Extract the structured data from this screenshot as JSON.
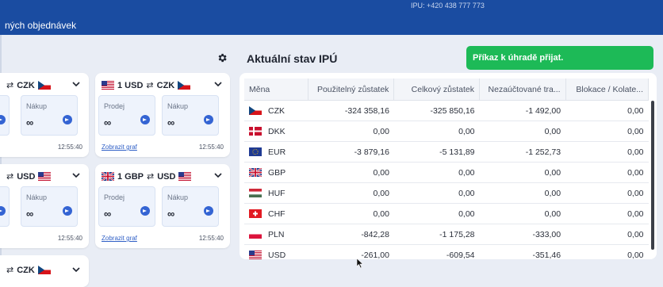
{
  "header": {
    "phone": "IPU: +420 438 777 773",
    "title": "ných objednávek"
  },
  "rates": [
    {
      "pair_base_amount": "",
      "pair_base": "",
      "pair_quote": "CZK",
      "buy_label": "Nákup",
      "buy_value": "∞",
      "time": "12:55:40"
    },
    {
      "pair_base_amount": "1 USD",
      "pair_quote": "CZK",
      "sell_label": "Prodej",
      "sell_value": "∞",
      "buy_label": "Nákup",
      "buy_value": "∞",
      "chart_link": "Zobrazit graf",
      "time": "12:55:40"
    },
    {
      "pair_quote": "USD",
      "buy_label": "Nákup",
      "buy_value": "∞",
      "time": "12:55:40"
    },
    {
      "pair_base_amount": "1 GBP",
      "pair_quote": "USD",
      "sell_label": "Prodej",
      "sell_value": "∞",
      "buy_label": "Nákup",
      "buy_value": "∞",
      "chart_link": "Zobrazit graf",
      "time": "12:55:40"
    },
    {
      "pair_quote": "CZK"
    }
  ],
  "status": {
    "title": "Aktuální stav IPÚ",
    "toast": "Příkaz k úhradě přijat."
  },
  "table": {
    "headers": [
      "Měna",
      "Použitelný zůstatek",
      "Celkový zůstatek",
      "Nezaúčtované tra...",
      "Blokace / Kolate..."
    ],
    "rows": [
      {
        "currency": "CZK",
        "flag": "cz",
        "usable": "-324 358,16",
        "total": "-325 850,16",
        "unposted": "-1 492,00",
        "blocked": "0,00"
      },
      {
        "currency": "DKK",
        "flag": "dk",
        "usable": "0,00",
        "total": "0,00",
        "unposted": "0,00",
        "blocked": "0,00"
      },
      {
        "currency": "EUR",
        "flag": "eu",
        "usable": "-3 879,16",
        "total": "-5 131,89",
        "unposted": "-1 252,73",
        "blocked": "0,00"
      },
      {
        "currency": "GBP",
        "flag": "gb",
        "usable": "0,00",
        "total": "0,00",
        "unposted": "0,00",
        "blocked": "0,00"
      },
      {
        "currency": "HUF",
        "flag": "hu",
        "usable": "0,00",
        "total": "0,00",
        "unposted": "0,00",
        "blocked": "0,00"
      },
      {
        "currency": "CHF",
        "flag": "ch",
        "usable": "0,00",
        "total": "0,00",
        "unposted": "0,00",
        "blocked": "0,00"
      },
      {
        "currency": "PLN",
        "flag": "pl",
        "usable": "-842,28",
        "total": "-1 175,28",
        "unposted": "-333,00",
        "blocked": "0,00"
      },
      {
        "currency": "USD",
        "flag": "us",
        "usable": "-261,00",
        "total": "-609,54",
        "unposted": "-351,46",
        "blocked": "0,00"
      }
    ]
  }
}
